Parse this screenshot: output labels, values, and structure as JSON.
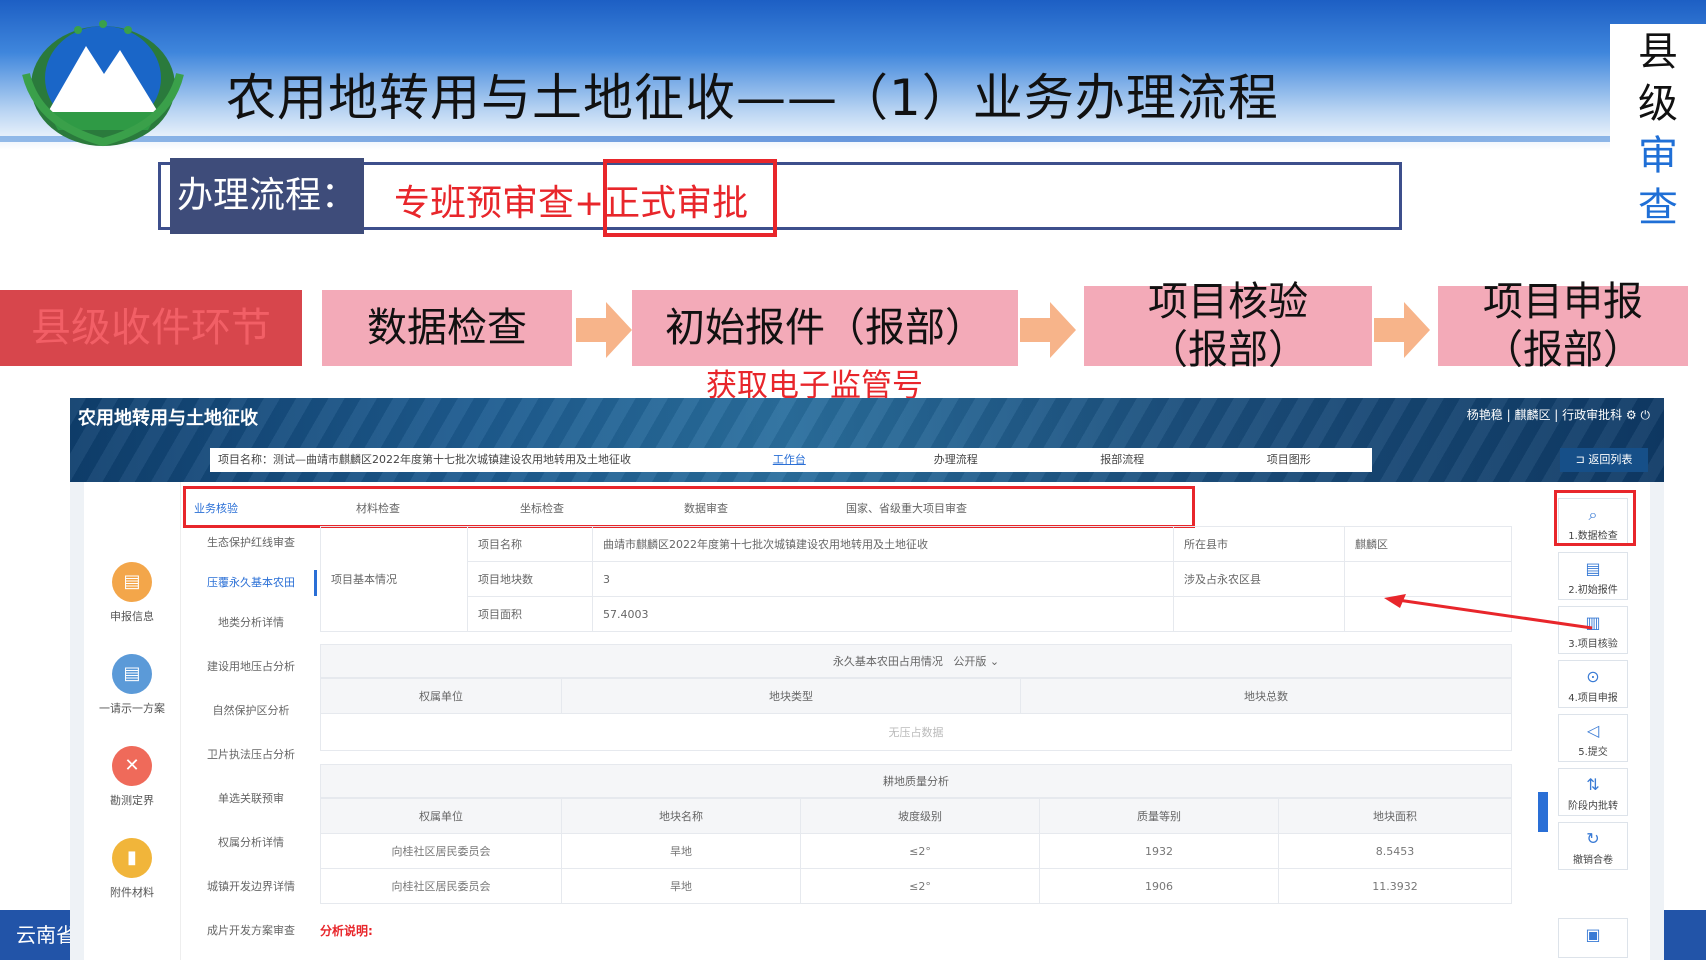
{
  "slide": {
    "title": "农用地转用与土地征收——（1）业务办理流程",
    "side_tag": [
      "县",
      "级",
      "审",
      "查"
    ],
    "flow_label": "办理流程：",
    "flow_text": "专班预审查+正式审批",
    "footer_text": "云南省"
  },
  "steps": [
    {
      "label": "县级收件环节"
    },
    {
      "label": "数据检查"
    },
    {
      "label": "初始报件（报部）"
    },
    {
      "label": "项目核验\n（报部）"
    },
    {
      "label": "项目申报\n（报部）"
    }
  ],
  "step_note": "获取电子监管号",
  "app": {
    "title": "农用地转用与土地征收",
    "user_bar": "杨艳稳 | 麒麟区 | 行政审批科 ⚙ ⏻",
    "project_label": "项目名称：测试—曲靖市麒麟区2022年度第十七批次城镇建设农用地转用及土地征收",
    "tabs": [
      "工作台",
      "办理流程",
      "报部流程",
      "项目图形"
    ],
    "back_button": "返回列表",
    "left_items": [
      {
        "label": "申报信息",
        "icon": "document-icon",
        "color": "#f3a64a"
      },
      {
        "label": "一请示一方案",
        "icon": "file-icon",
        "color": "#5b9ad8"
      },
      {
        "label": "勘测定界",
        "icon": "cross-icon",
        "color": "#ef6a5a"
      },
      {
        "label": "附件材料",
        "icon": "attachment-icon",
        "color": "#f1b53a"
      }
    ],
    "top_tabs": [
      "业务核验",
      "材料检查",
      "坐标检查",
      "数据审查",
      "国家、省级重大项目审查"
    ],
    "sub_nav": [
      "生态保护红线审查",
      "压覆永久基本农田",
      "地类分析详情",
      "建设用地压占分析",
      "自然保护区分析",
      "卫片执法压占分析",
      "单选关联预审",
      "权属分析详情",
      "城镇开发边界详情",
      "成片开发方案审查"
    ],
    "basic_info": {
      "section": "项目基本情况",
      "rows": [
        {
          "k": "项目名称",
          "v": "曲靖市麒麟区2022年度第十七批次城镇建设农用地转用及土地征收",
          "k2": "所在县市",
          "v2": "麒麟区"
        },
        {
          "k": "项目地块数",
          "v": "3",
          "k2": "涉及占永农区县",
          "v2": ""
        },
        {
          "k": "项目面积",
          "v": "57.4003",
          "k2": "",
          "v2": ""
        }
      ]
    },
    "farmland": {
      "title": "永久基本农田占用情况",
      "version": "公开版 ⌄",
      "headers": [
        "权属单位",
        "地块类型",
        "地块总数"
      ],
      "empty": "无压占数据"
    },
    "quality": {
      "title": "耕地质量分析",
      "headers": [
        "权属单位",
        "地块名称",
        "坡度级别",
        "质量等别",
        "地块面积"
      ],
      "rows": [
        [
          "向桂社区居民委员会",
          "旱地",
          "≤2°",
          "1932",
          "8.5453"
        ],
        [
          "向桂社区居民委员会",
          "旱地",
          "≤2°",
          "1906",
          "11.3932"
        ]
      ]
    },
    "analysis_label": "分析说明:",
    "right_buttons": [
      {
        "label": "1.数据检查",
        "icon": "⌕"
      },
      {
        "label": "2.初始报件",
        "icon": "▤"
      },
      {
        "label": "3.项目核验",
        "icon": "▥"
      },
      {
        "label": "4.项目申报",
        "icon": "⊙"
      },
      {
        "label": "5.提交",
        "icon": "◁"
      },
      {
        "label": "阶段内批转",
        "icon": "⇅"
      },
      {
        "label": "撤销合卷",
        "icon": "↻"
      },
      {
        "label": "",
        "icon": "▣"
      }
    ]
  }
}
